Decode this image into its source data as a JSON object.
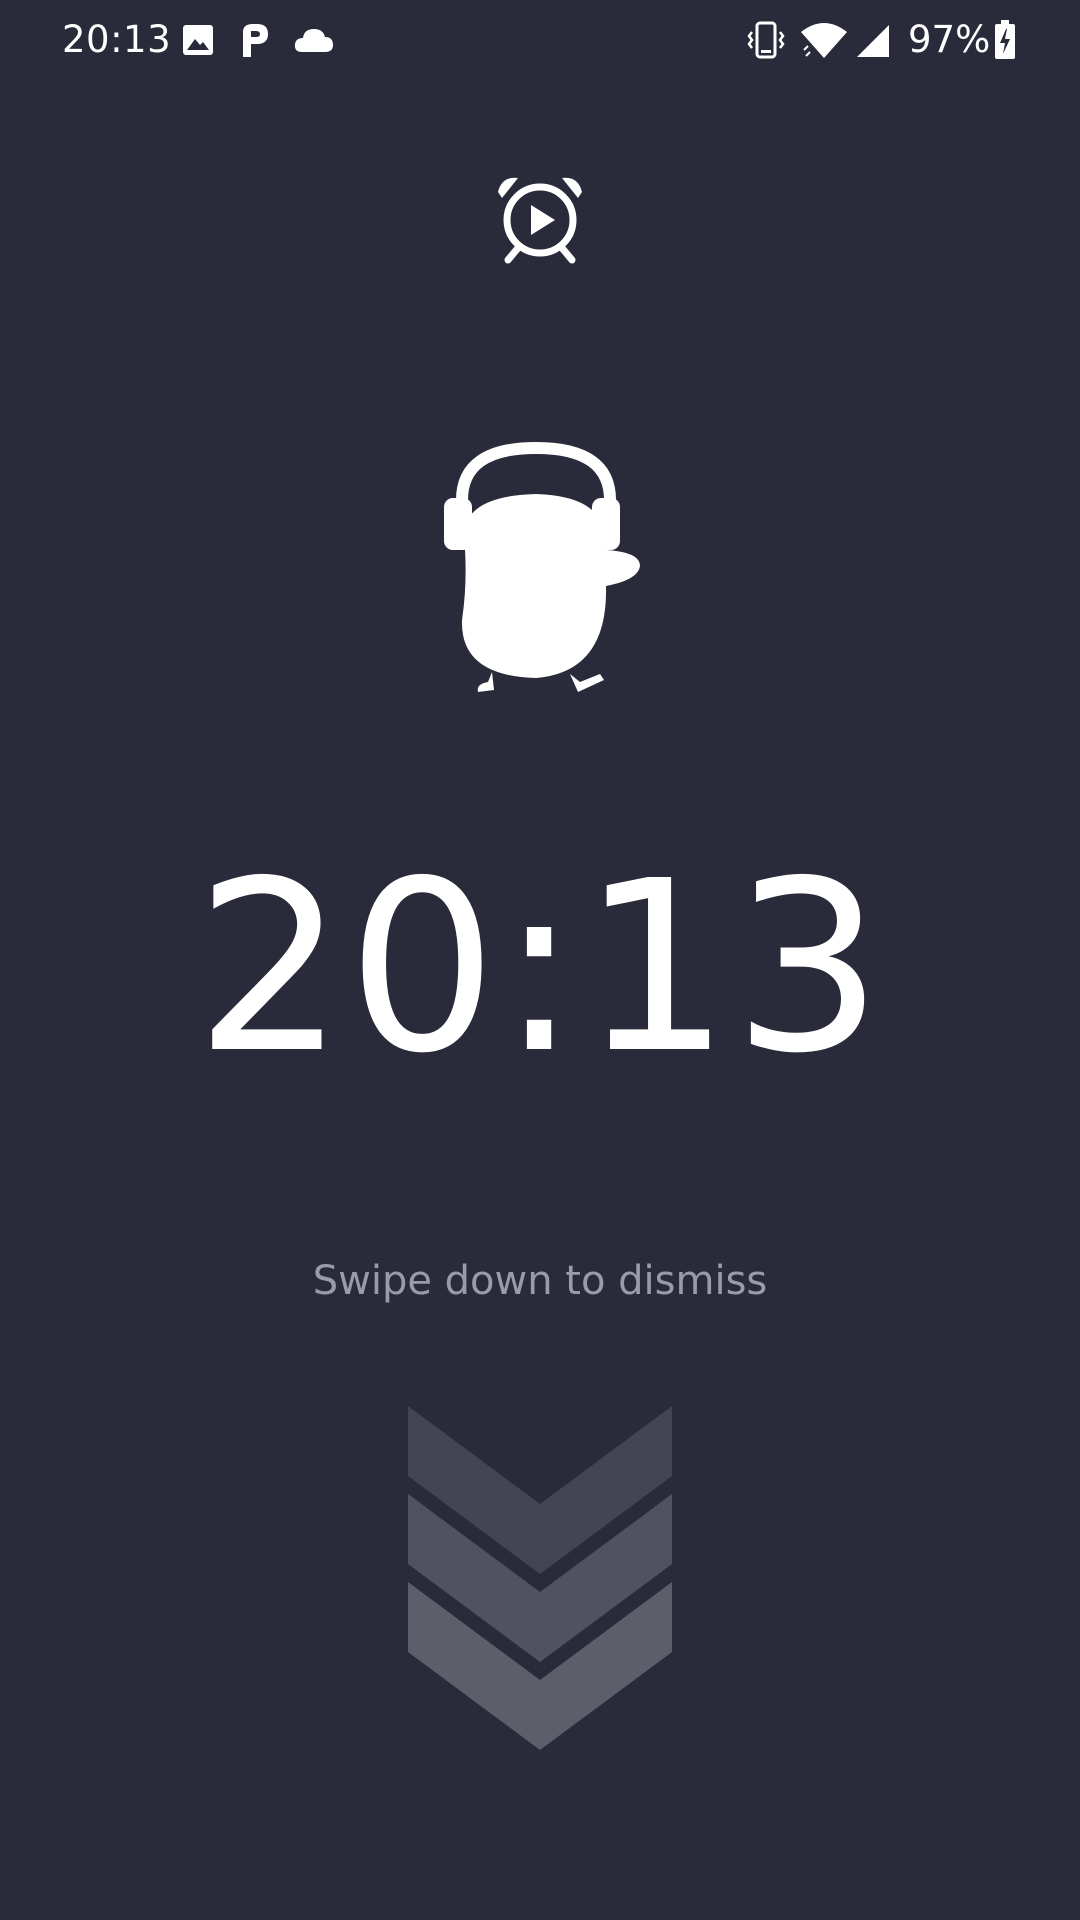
{
  "status_bar": {
    "time": "20:13",
    "battery_percent": "97%",
    "notification_icons": [
      "image-icon",
      "parking-icon",
      "cloud-icon"
    ],
    "system_icons": [
      "vibrate-icon",
      "wifi-icon",
      "cell-signal-icon",
      "battery-charging-icon"
    ]
  },
  "alarm": {
    "icon": "alarm-clock-play-icon",
    "mascot": "headphone-bird-mascot",
    "time": "20:13",
    "dismiss_hint": "Swipe down to dismiss",
    "swipe_icon": "triple-chevron-down-icon"
  },
  "colors": {
    "background": "#2a2b3a",
    "foreground": "#ffffff",
    "hint_text": "#9a9ba6",
    "chevron_1": "#444553",
    "chevron_2": "#51525f",
    "chevron_3": "#5d5e6a"
  }
}
